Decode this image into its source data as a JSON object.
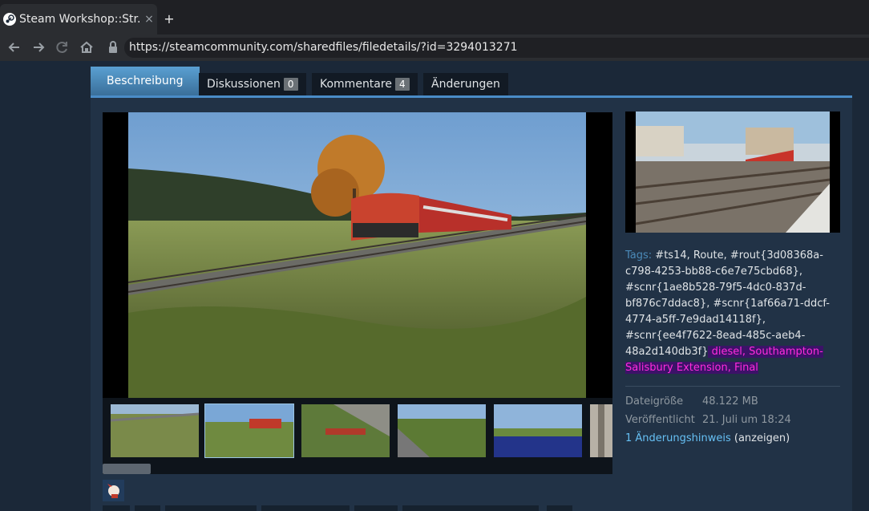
{
  "browser": {
    "tab_title": "Steam Workshop::Str...",
    "close_glyph": "×",
    "new_tab_glyph": "+",
    "url": "https://steamcommunity.com/sharedfiles/filedetails/?id=3294013271",
    "icons": [
      "steam-favicon",
      "back-arrow",
      "forward-arrow",
      "reload",
      "home",
      "lock"
    ]
  },
  "tabs": [
    {
      "label": "Beschreibung",
      "active": true
    },
    {
      "label": "Diskussionen",
      "count": "0"
    },
    {
      "label": "Kommentare",
      "count": "4"
    },
    {
      "label": "Änderungen"
    }
  ],
  "details": {
    "tags_label": "Tags:",
    "tags_text": " #ts14, Route, #rout{3d08368a-c798-4253-bb88-c6e7e75cbd68}, #scnr{1ae8b528-79f5-4dc0-837d-bf876c7ddac8}, #scnr{1af66a71-ddcf-4774-a5ff-7e9dad14118f}, #scnr{ee4f7622-8ead-485c-aeb4-48a2d140db3f}",
    "tags_highlight": " diesel, Southampton-Salisbury Extension, Final",
    "file_size_label": "Dateigröße",
    "file_size": "48.122 MB",
    "published_label": "Veröffentlicht",
    "published": "21. Juli um 18:24",
    "change_notes_link": "1 Änderungshinweis",
    "change_notes_view": " (anzeigen)"
  },
  "colors": {
    "accent": "#4a8cc7",
    "link": "#66c0f4",
    "highlight_text": "#ff2bdc",
    "highlight_bg": "#3c1268"
  },
  "media": {
    "thumbnail_count": 6,
    "selected_thumbnail": 2,
    "gallery_scroll_position": 0
  }
}
